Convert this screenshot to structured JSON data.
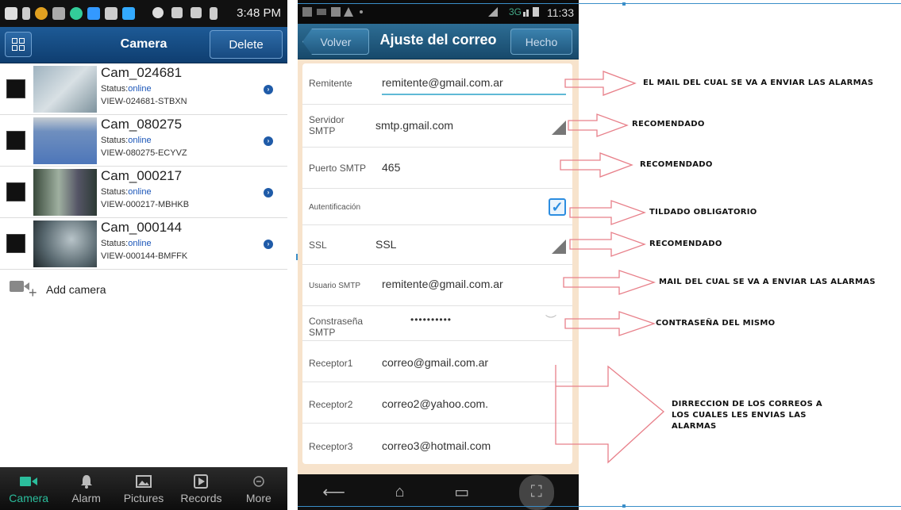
{
  "left_phone": {
    "status_time": "3:48 PM",
    "title": "Camera",
    "delete_label": "Delete",
    "cameras": [
      {
        "name": "Cam_024681",
        "status_label": "Status:",
        "status": "online",
        "id": "VIEW-024681-STBXN"
      },
      {
        "name": "Cam_080275",
        "status_label": "Status:",
        "status": "online",
        "id": "VIEW-080275-ECYVZ"
      },
      {
        "name": "Cam_000217",
        "status_label": "Status:",
        "status": "online",
        "id": "VIEW-000217-MBHKB"
      },
      {
        "name": "Cam_000144",
        "status_label": "Status:",
        "status": "online",
        "id": "VIEW-000144-BMFFK"
      }
    ],
    "add_camera_label": "Add camera",
    "tabs": [
      {
        "label": "Camera",
        "icon": "video-icon",
        "active": true
      },
      {
        "label": "Alarm",
        "icon": "bell-icon",
        "active": false
      },
      {
        "label": "Pictures",
        "icon": "image-icon",
        "active": false
      },
      {
        "label": "Records",
        "icon": "play-icon",
        "active": false
      },
      {
        "label": "More",
        "icon": "more-icon",
        "active": false
      }
    ],
    "accent_color": "#2bbd9c",
    "header_color": "#1d5a96"
  },
  "right_phone": {
    "status_time": "11:33",
    "status_network": "3G",
    "back_label": "Volver",
    "title": "Ajuste del correo",
    "done_label": "Hecho",
    "fields": [
      {
        "label": "Remitente",
        "value": "remitente@gmail.com.ar"
      },
      {
        "label": "Servidor SMTP",
        "value": "smtp.gmail.com"
      },
      {
        "label": "Puerto SMTP",
        "value": "465"
      },
      {
        "label": "Autentificación",
        "value": ""
      },
      {
        "label": "SSL",
        "value": "SSL"
      },
      {
        "label": "Usuario SMTP",
        "value": "remitente@gmail.com.ar"
      },
      {
        "label": "Constraseña SMTP",
        "value": "••••••••••"
      },
      {
        "label": "Receptor1",
        "value": "correo@gmail.com.ar"
      },
      {
        "label": "Receptor2",
        "value": "correo2@yahoo.com."
      },
      {
        "label": "Receptor3",
        "value": "correo3@hotmail.com"
      }
    ],
    "checkbox_checked": true,
    "header_color": "#17496b"
  },
  "annotations": {
    "remitente": "EL MAIL DEL CUAL SE VA A ENVIAR LAS ALARMAS",
    "servidor": "RECOMENDADO",
    "puerto": "RECOMENDADO",
    "autentificacion": "TILDADO OBLIGATORIO",
    "ssl": "RECOMENDADO",
    "usuario": "MAIL DEL CUAL SE VA A ENVIAR LAS ALARMAS",
    "contrasena": "CONTRASEÑA DEL MISMO",
    "receptores_line1": "DIRRECCION DE LOS CORREOS A",
    "receptores_line2": "LOS CUALES LES ENVIAS LAS",
    "receptores_line3": "ALARMAS"
  }
}
